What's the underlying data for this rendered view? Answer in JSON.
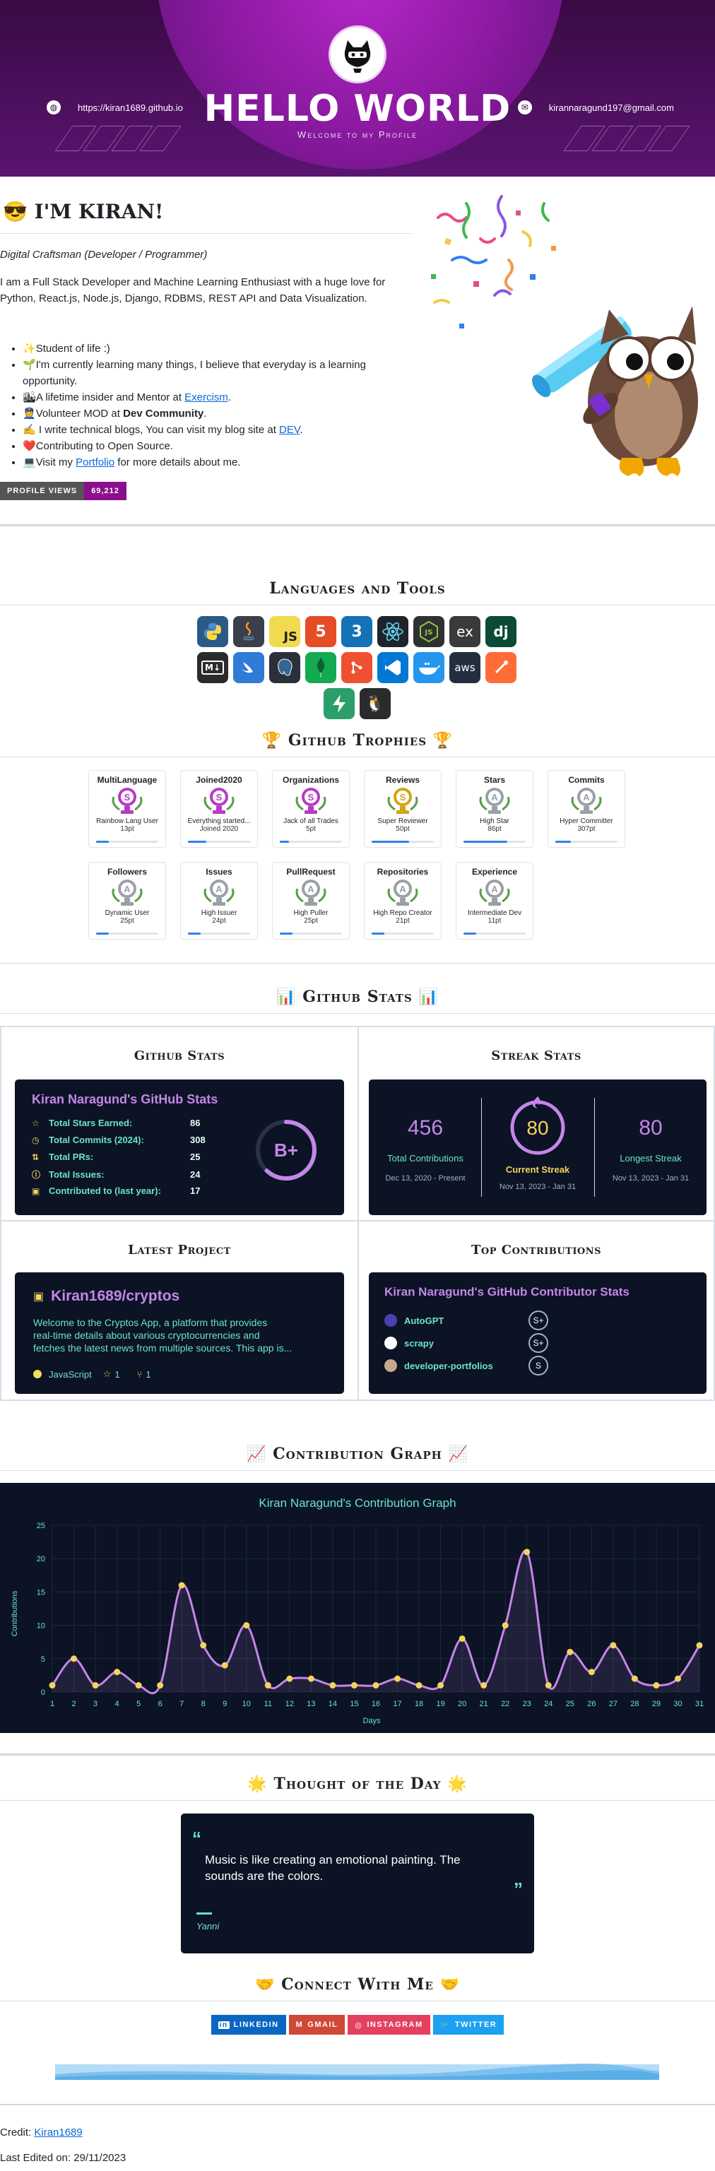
{
  "header": {
    "title": "HELLO WORLD",
    "subtitle": "Welcome to my Profile",
    "website": "https://kiran1689.github.io",
    "email": "kirannaragund197@gmail.com"
  },
  "intro": {
    "heading": "I'M KIRAN!",
    "heading_emoji": "😎",
    "role": "Digital Craftsman (Developer / Programmer)",
    "bio": "I am a Full Stack Developer and Machine Learning Enthusiast with a huge love for Python, React.js, Node.js, Django, RDBMS, REST API and Data Visualization.",
    "bullets": [
      {
        "emoji": "✨",
        "text": "Student of life :)"
      },
      {
        "emoji": "🌱",
        "text": "I'm currently learning many things, I believe that everyday is a learning opportunity."
      },
      {
        "emoji": "🏙",
        "text_before": "A lifetime insider and Mentor at ",
        "link": "Exercism",
        "text_after": "."
      },
      {
        "emoji": "👮",
        "text_before": "Volunteer MOD at ",
        "bold": "Dev Community",
        "text_after": "."
      },
      {
        "emoji": "✍️",
        "text_before": " I write technical blogs, You can visit my blog site at ",
        "link": "DEV",
        "text_after": "."
      },
      {
        "emoji": "❤️",
        "text": "Contributing to Open Source."
      },
      {
        "emoji": "💻",
        "text_before": "Visit my ",
        "link": "Portfolio",
        "text_after": " for more details about me."
      }
    ],
    "profile_views_label": "PROFILE VIEWS",
    "profile_views_value": "69,212"
  },
  "languages": {
    "title": "Languages and Tools",
    "tools": [
      {
        "name": "python",
        "label": "",
        "bg": "#2b5b84"
      },
      {
        "name": "java",
        "label": "",
        "bg": "#3a3f4b"
      },
      {
        "name": "javascript",
        "label": "JS",
        "bg": "#f0db4f"
      },
      {
        "name": "html5",
        "label": "5",
        "bg": "#e44d26"
      },
      {
        "name": "css3",
        "label": "3",
        "bg": "#1572b6"
      },
      {
        "name": "react",
        "label": "⚛",
        "bg": "#20232a"
      },
      {
        "name": "nodejs",
        "label": "JS",
        "bg": "#303030"
      },
      {
        "name": "express",
        "label": "ex",
        "bg": "#3a3a3a"
      },
      {
        "name": "django",
        "label": "dj",
        "bg": "#0c4b33"
      },
      {
        "name": "markdown",
        "label": "M↓",
        "bg": "#2b2b2b"
      },
      {
        "name": "swift",
        "label": "",
        "bg": "#2f7bd6"
      },
      {
        "name": "postgresql",
        "label": "",
        "bg": "#2a2f3a"
      },
      {
        "name": "mongodb",
        "label": "",
        "bg": "#13aa52"
      },
      {
        "name": "git",
        "label": "",
        "bg": "#f05032"
      },
      {
        "name": "vscode",
        "label": "",
        "bg": "#0078d4"
      },
      {
        "name": "docker",
        "label": "",
        "bg": "#2496ed"
      },
      {
        "name": "aws",
        "label": "aws",
        "bg": "#232f3e"
      },
      {
        "name": "postman",
        "label": "",
        "bg": "#ff6c37"
      },
      {
        "name": "supabase",
        "label": "",
        "bg": "#2b9e6a"
      },
      {
        "name": "linux",
        "label": "🐧",
        "bg": "#2b2b2b"
      }
    ]
  },
  "trophies": {
    "title": "Github Trophies",
    "title_emoji": "🏆",
    "items": [
      {
        "name": "MultiLanguage",
        "rank": "S",
        "desc": "Rainbow Lang User",
        "pt": "13pt",
        "color": "#b83ac4",
        "progress": 0.2
      },
      {
        "name": "Joined2020",
        "rank": "S",
        "desc": "Everything started...",
        "pt": "Joined 2020",
        "color": "#b83ac4",
        "progress": 0.3
      },
      {
        "name": "Organizations",
        "rank": "S",
        "desc": "Jack of all Trades",
        "pt": "5pt",
        "color": "#b83ac4",
        "progress": 0.15
      },
      {
        "name": "Reviews",
        "rank": "S",
        "desc": "Super Reviewer",
        "pt": "50pt",
        "color": "#d4a417",
        "progress": 0.6
      },
      {
        "name": "Stars",
        "rank": "A",
        "desc": "High Star",
        "pt": "86pt",
        "color": "#9aa0a6",
        "progress": 0.7
      },
      {
        "name": "Commits",
        "rank": "A",
        "desc": "Hyper Committer",
        "pt": "307pt",
        "color": "#9aa0a6",
        "progress": 0.25
      },
      {
        "name": "Followers",
        "rank": "A",
        "desc": "Dynamic User",
        "pt": "25pt",
        "color": "#9aa0a6",
        "progress": 0.2
      },
      {
        "name": "Issues",
        "rank": "A",
        "desc": "High Issuer",
        "pt": "24pt",
        "color": "#9aa0a6",
        "progress": 0.2
      },
      {
        "name": "PullRequest",
        "rank": "A",
        "desc": "High Puller",
        "pt": "25pt",
        "color": "#9aa0a6",
        "progress": 0.2
      },
      {
        "name": "Repositories",
        "rank": "A",
        "desc": "High Repo Creator",
        "pt": "21pt",
        "color": "#9aa0a6",
        "progress": 0.2
      },
      {
        "name": "Experience",
        "rank": "A",
        "desc": "Intermediate Dev",
        "pt": "11pt",
        "color": "#9aa0a6",
        "progress": 0.2
      }
    ]
  },
  "stats": {
    "title": "Github Stats",
    "title_emoji": "📊",
    "github_stats": {
      "heading": "Github Stats",
      "card_title": "Kiran Naragund's GitHub Stats",
      "rows": [
        {
          "icon": "☆",
          "label": "Total Stars Earned:",
          "value": "86"
        },
        {
          "icon": "◷",
          "label": "Total Commits (2024):",
          "value": "308"
        },
        {
          "icon": "⇅",
          "label": "Total PRs:",
          "value": "25"
        },
        {
          "icon": "ⓘ",
          "label": "Total Issues:",
          "value": "24"
        },
        {
          "icon": "▣",
          "label": "Contributed to (last year):",
          "value": "17"
        }
      ],
      "grade": "B+",
      "grade_progress": 0.62
    },
    "streak": {
      "heading": "Streak Stats",
      "total": "456",
      "total_label": "Total Contributions",
      "total_range": "Dec 13, 2020 - Present",
      "current": "80",
      "current_label": "Current Streak",
      "current_range": "Nov 13, 2023 - Jan 31",
      "longest": "80",
      "longest_label": "Longest Streak",
      "longest_range": "Nov 13, 2023 - Jan 31"
    },
    "latest_project": {
      "heading": "Latest Project",
      "repo": "Kiran1689/cryptos",
      "desc_line1": "Welcome to the Cryptos App, a platform that provides",
      "desc_line2": "real-time details about various cryptocurrencies and",
      "desc_line3": "fetches the latest news from multiple sources. This app is...",
      "language": "JavaScript",
      "stars": "1",
      "forks": "1"
    },
    "top_contributions": {
      "heading": "Top Contributions",
      "card_title": "Kiran Naragund's GitHub Contributor Stats",
      "repos": [
        {
          "name": "AutoGPT",
          "rank": "S+"
        },
        {
          "name": "scrapy",
          "rank": "S+"
        },
        {
          "name": "developer-portfolios",
          "rank": "S"
        }
      ]
    }
  },
  "contribution_graph": {
    "title": "Contribution Graph",
    "title_emoji": "📈"
  },
  "chart_data": {
    "type": "line",
    "title": "Kiran Naragund's Contribution Graph",
    "xlabel": "Days",
    "ylabel": "Contributions",
    "x": [
      1,
      2,
      3,
      4,
      5,
      6,
      7,
      8,
      9,
      10,
      11,
      12,
      13,
      14,
      15,
      16,
      17,
      18,
      19,
      20,
      21,
      22,
      23,
      24,
      25,
      26,
      27,
      28,
      29,
      30,
      31
    ],
    "values": [
      1,
      5,
      1,
      3,
      1,
      1,
      16,
      7,
      4,
      10,
      1,
      2,
      2,
      1,
      1,
      1,
      2,
      1,
      1,
      8,
      1,
      10,
      21,
      1,
      6,
      3,
      7,
      2,
      1,
      2,
      7
    ],
    "ylim": [
      0,
      25
    ],
    "yticks": [
      0,
      5,
      10,
      15,
      20,
      25
    ],
    "grid": true
  },
  "quote": {
    "title": "Thought of the Day",
    "title_emoji": "🌟",
    "text_line1": "Music is like creating an emotional painting. The",
    "text_line2": "sounds are the colors.",
    "author": "Yanni"
  },
  "connect": {
    "title": "Connect With Me",
    "title_emoji": "🤝",
    "badges": [
      {
        "name": "linkedin",
        "label": "LINKEDIN",
        "color": "#0a66c2",
        "icon": "in"
      },
      {
        "name": "gmail",
        "label": "GMAIL",
        "color": "#d14836",
        "icon": "M"
      },
      {
        "name": "instagram",
        "label": "INSTAGRAM",
        "color": "#e4405f",
        "icon": "◎"
      },
      {
        "name": "twitter",
        "label": "TWITTER",
        "color": "#1ca0f2",
        "icon": "🐦"
      }
    ]
  },
  "footer": {
    "credit_label": "Credit: ",
    "credit_link": "Kiran1689",
    "last_edited": "Last Edited on: 29/11/2023"
  }
}
